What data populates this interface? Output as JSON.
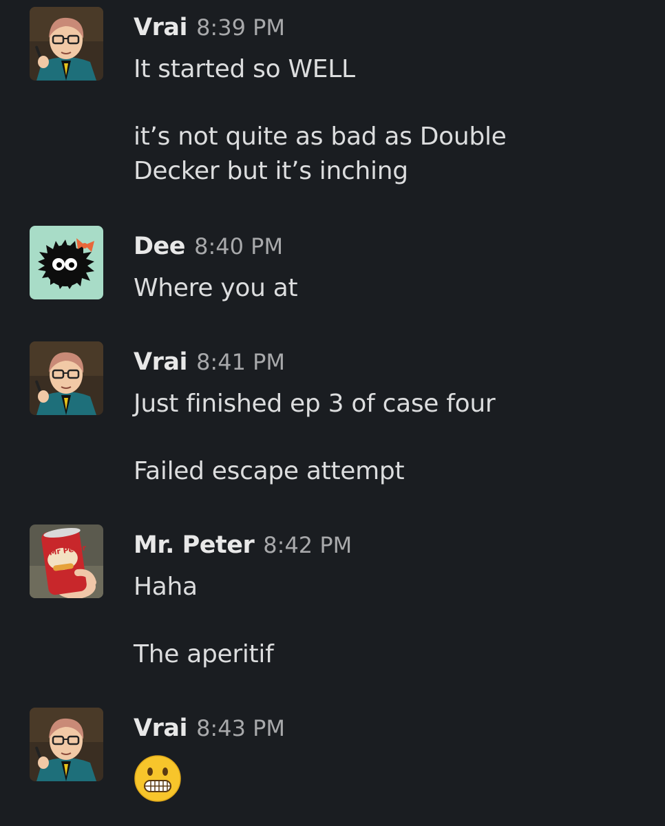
{
  "messages": [
    {
      "author": "Vrai",
      "time": "8:39 PM",
      "avatar_icon": "vrai-avatar-icon",
      "lines": [
        "It started so WELL",
        "it’s not quite as bad as Double",
        "Decker but it’s inching"
      ]
    },
    {
      "author": "Dee",
      "time": "8:40 PM",
      "avatar_icon": "soot-sprite-avatar-icon",
      "lines": [
        "Where you at"
      ]
    },
    {
      "author": "Vrai",
      "time": "8:41 PM",
      "avatar_icon": "vrai-avatar-icon",
      "lines": [
        "Just finished ep 3 of case four",
        "Failed escape attempt"
      ]
    },
    {
      "author": "Mr. Peter",
      "time": "8:42 PM",
      "avatar_icon": "soda-can-avatar-icon",
      "avatar_text": "Mr Peter",
      "lines": [
        "Haha",
        "The aperitif"
      ]
    },
    {
      "author": "Vrai",
      "time": "8:43 PM",
      "avatar_icon": "vrai-avatar-icon",
      "emoji": "grimacing-face-emoji"
    }
  ],
  "colors": {
    "background": "#1a1d21",
    "text": "#dcddde",
    "name": "#e8e8e8",
    "timestamp": "#a8a9ab",
    "dee_avatar_bg": "#a8dcc7",
    "soda_red": "#c8272b"
  }
}
